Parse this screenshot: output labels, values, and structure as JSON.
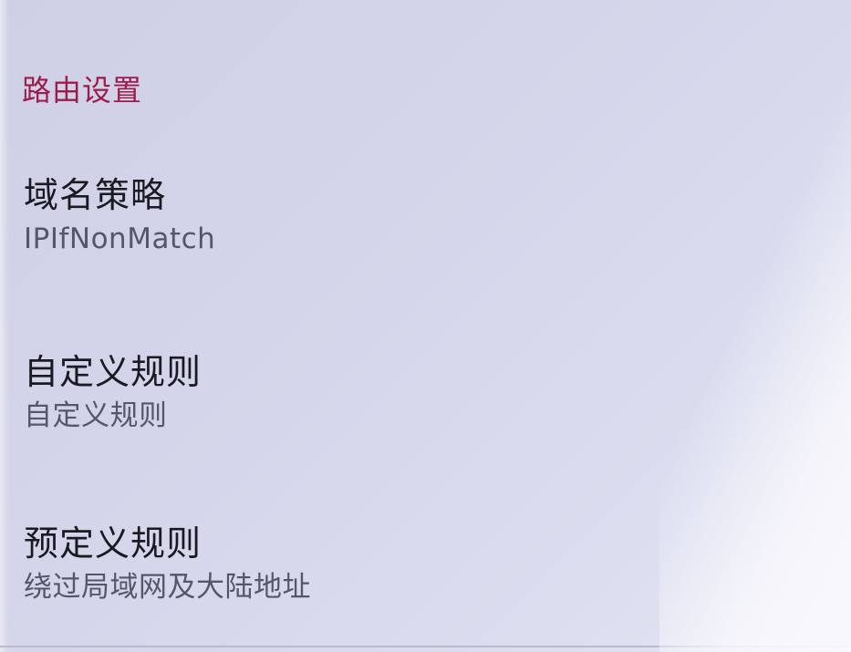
{
  "section": {
    "title": "路由设置"
  },
  "items": [
    {
      "title": "域名策略",
      "summary": "IPIfNonMatch"
    },
    {
      "title": "自定义规则",
      "summary": "自定义规则"
    },
    {
      "title": "预定义规则",
      "summary": "绕过局域网及大陆地址"
    }
  ],
  "colors": {
    "accent": "#9c1d4b",
    "title": "#1a1a22",
    "summary": "#55566a",
    "background": "#d4d5ea"
  }
}
